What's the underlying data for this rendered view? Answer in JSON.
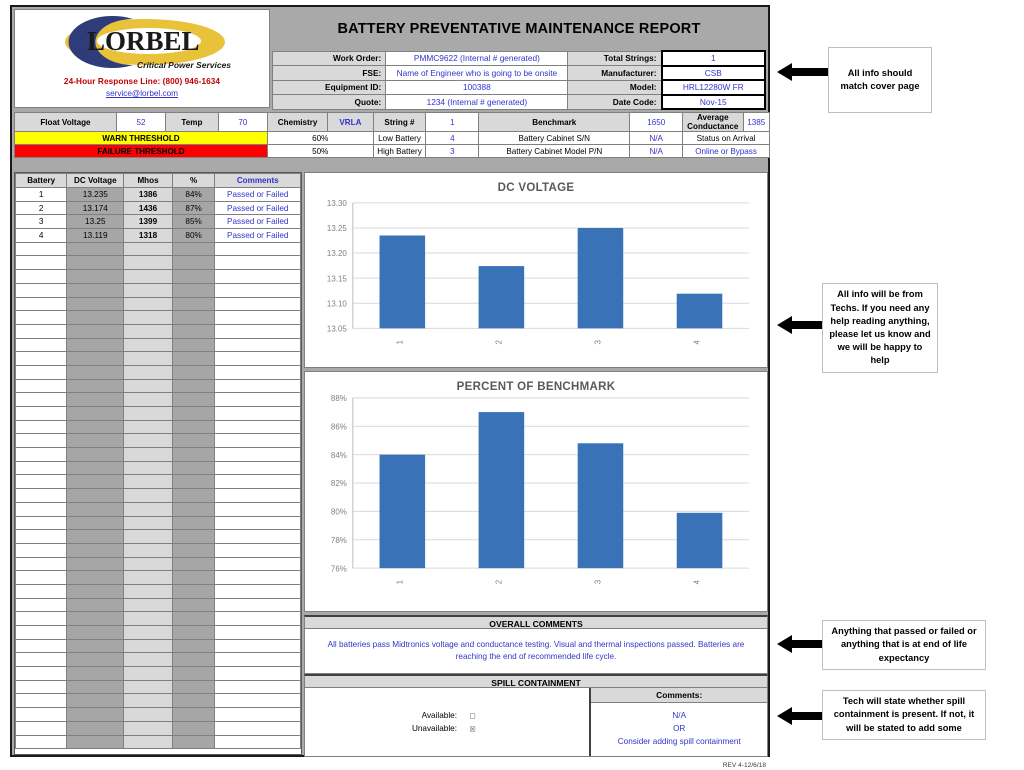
{
  "company": {
    "name": "LORBEL",
    "tagline": "Critical Power Services",
    "response_line": "24-Hour Response Line: (800) 946-1634",
    "email": "service@lorbel.com",
    "logo_blue": "#2e3d7a",
    "logo_gold": "#e8c33a"
  },
  "report": {
    "title": "BATTERY PREVENTATIVE MAINTENANCE REPORT",
    "revision": "REV 4-12/6/18"
  },
  "header_left": [
    {
      "label": "Work Order:",
      "value": "PMMC9622 (Internal # generated)"
    },
    {
      "label": "FSE:",
      "value": "Name of Engineer who is going to be onsite"
    },
    {
      "label": "Equipment ID:",
      "value": "100388"
    },
    {
      "label": "Quote:",
      "value": "1234 (Internal # generated)"
    }
  ],
  "header_right": [
    {
      "label": "Total Strings:",
      "value": "1"
    },
    {
      "label": "Manufacturer:",
      "value": "CSB"
    },
    {
      "label": "Model:",
      "value": "HRL12280W FR"
    },
    {
      "label": "Date Code:",
      "value": "Nov-15"
    }
  ],
  "params": {
    "row1": {
      "float_voltage_label": "Float Voltage",
      "float_voltage_value": "52",
      "temp_label": "Temp",
      "temp_value": "70",
      "chemistry_label": "Chemistry",
      "chemistry_value": "VRLA",
      "string_label": "String #",
      "string_value": "1",
      "benchmark_label": "Benchmark",
      "benchmark_value": "1650",
      "avg_cond_label": "Average Conductance",
      "avg_cond_value": "1385"
    },
    "row2": {
      "threshold_label": "WARN THRESHOLD",
      "threshold_pct": "60%",
      "battery_label": "Low Battery",
      "battery_value": "4",
      "cabinet_label": "Battery Cabinet S/N",
      "cabinet_value": "N/A",
      "status_label": "Status on Arrival"
    },
    "row3": {
      "threshold_label": "FAILURE THRESHOLD",
      "threshold_pct": "50%",
      "battery_label": "High Battery",
      "battery_value": "3",
      "cabinet_label": "Battery Cabinet Model P/N",
      "cabinet_value": "N/A",
      "status_value": "Online or Bypass"
    }
  },
  "battery_table": {
    "columns": [
      "Battery",
      "DC Voltage",
      "Mhos",
      "%",
      "Comments"
    ],
    "rows": [
      {
        "battery": "1",
        "dc_voltage": "13.235",
        "mhos": "1386",
        "pct": "84%",
        "comments": "Passed or Failed"
      },
      {
        "battery": "2",
        "dc_voltage": "13.174",
        "mhos": "1436",
        "pct": "87%",
        "comments": "Passed or Failed"
      },
      {
        "battery": "3",
        "dc_voltage": "13.25",
        "mhos": "1399",
        "pct": "85%",
        "comments": "Passed or Failed"
      },
      {
        "battery": "4",
        "dc_voltage": "13.119",
        "mhos": "1318",
        "pct": "80%",
        "comments": "Passed or Failed"
      }
    ],
    "empty_row_count": 37
  },
  "chart_data": [
    {
      "type": "bar",
      "title": "DC VOLTAGE",
      "categories": [
        "1",
        "2",
        "3",
        "4"
      ],
      "values": [
        13.235,
        13.174,
        13.25,
        13.119
      ],
      "tick_labels": [
        "13.05",
        "13.10",
        "13.15",
        "13.20",
        "13.25",
        "13.30"
      ],
      "ticks": [
        13.05,
        13.1,
        13.15,
        13.2,
        13.25,
        13.3
      ],
      "ylim": [
        13.05,
        13.3
      ],
      "xlabel": "",
      "ylabel": "",
      "grid": true,
      "legend": false,
      "bar_color": "#3a72b8"
    },
    {
      "type": "bar",
      "title": "PERCENT OF BENCHMARK",
      "categories": [
        "1",
        "2",
        "3",
        "4"
      ],
      "values": [
        84.0,
        87.0,
        84.8,
        79.9
      ],
      "tick_labels": [
        "76%",
        "78%",
        "80%",
        "82%",
        "84%",
        "86%",
        "88%"
      ],
      "ticks": [
        76,
        78,
        80,
        82,
        84,
        86,
        88
      ],
      "ylim": [
        76,
        88
      ],
      "xlabel": "",
      "ylabel": "",
      "grid": true,
      "legend": false,
      "bar_color": "#3a72b8"
    }
  ],
  "overall_comments": {
    "header": "OVERALL COMMENTS",
    "text": "All batteries pass Midtronics voltage and conductance testing. Visual and thermal inspections passed. Batteries are reaching the end of recommended life cycle."
  },
  "spill_containment": {
    "header": "SPILL CONTAINMENT",
    "available_label": "Available:",
    "unavailable_label": "Unavailable:",
    "comments_label": "Comments:",
    "comment_line1": "N/A",
    "comment_line2": "OR",
    "comment_line3": "Consider adding spill containment"
  },
  "annotations": [
    {
      "text": "All info should match cover page"
    },
    {
      "text": "All info will be from Techs. If you need any help reading anything, please let us know and we will be happy to help"
    },
    {
      "text": "Anything that passed or failed or anything that is at end of life expectancy"
    },
    {
      "text": "Tech will state whether spill containment is present. If not, it will be stated to add some"
    }
  ]
}
